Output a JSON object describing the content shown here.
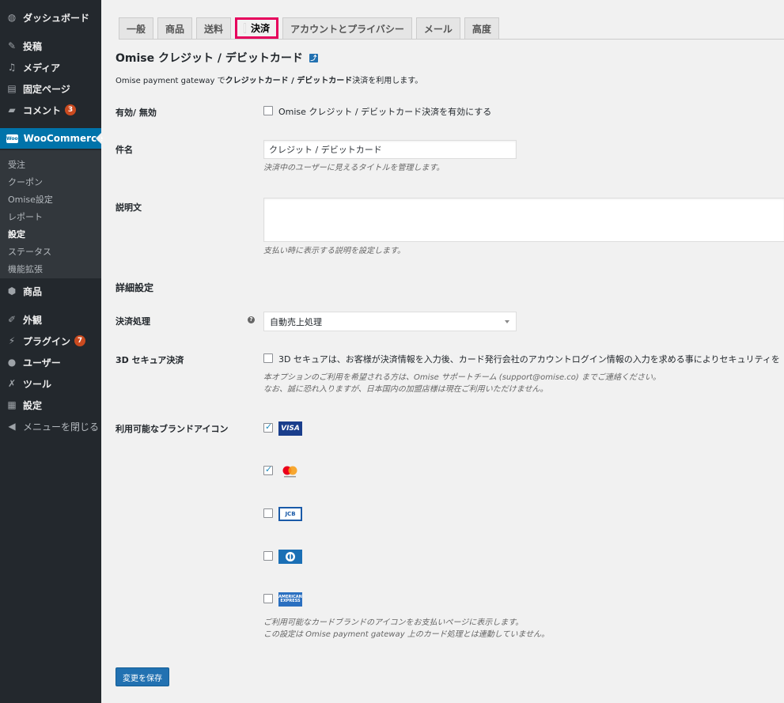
{
  "sidebar": {
    "dashboard": "ダッシュボード",
    "posts": "投稿",
    "media": "メディア",
    "pages": "固定ページ",
    "comments": "コメント",
    "comments_badge": "3",
    "woocommerce": "WooCommerce",
    "woo_logo": "Woo",
    "submenu": [
      "受注",
      "クーポン",
      "Omise設定",
      "レポート",
      "設定",
      "ステータス",
      "機能拡張"
    ],
    "products": "商品",
    "appearance": "外観",
    "plugins": "プラグイン",
    "plugins_badge": "7",
    "users": "ユーザー",
    "tools": "ツール",
    "settings": "設定",
    "collapse": "メニューを閉じる"
  },
  "tabs": [
    "一般",
    "商品",
    "送料",
    "決済",
    "アカウントとプライバシー",
    "メール",
    "高度"
  ],
  "active_tab": "決済",
  "page": {
    "title": "Omise クレジット / デビットカード",
    "back_icon": "⤴",
    "description_prefix": "Omise payment gateway で",
    "description_bold": "クレジットカード / デビットカード",
    "description_suffix": "決済を利用します。"
  },
  "form": {
    "enabled_label": "有効/ 無効",
    "enabled_checkbox_label": "Omise クレジット / デビットカード決済を有効にする",
    "enabled_checked": false,
    "title_label": "件名",
    "title_value": "クレジット / デビットカード",
    "title_hint": "決済中のユーザーに見えるタイトルを管理します。",
    "description_label": "説明文",
    "description_value": "",
    "description_hint": "支払い時に表示する説明を設定します。",
    "advanced_heading": "詳細設定",
    "payment_action_label": "決済処理",
    "payment_action_value": "自動売上処理",
    "secure3d_label": "3D セキュア決済",
    "secure3d_checkbox_label": "3D セキュアは、お客様が決済情報を入力後、カード発行会社のアカウントログイン情報の入力を求める事によりセキュリティを",
    "secure3d_checked": false,
    "secure3d_hint_1": "本オプションのご利用を希望される方は、Omise サポートチーム (support@omise.co) までご連絡ください。",
    "secure3d_hint_2": "なお、誠に恐れ入りますが、日本国内の加盟店様は現在ご利用いただけません。",
    "brands_label": "利用可能なブランドアイコン",
    "brands": [
      {
        "name": "visa",
        "text": "VISA",
        "checked": true
      },
      {
        "name": "mastercard",
        "text": "mastercard",
        "checked": true
      },
      {
        "name": "jcb",
        "text": "JCB",
        "checked": false
      },
      {
        "name": "diners",
        "text": "D",
        "checked": false
      },
      {
        "name": "amex",
        "text": "AMERICAN EXPRESS",
        "checked": false
      }
    ],
    "brands_hint_1": "ご利用可能なカードブランドのアイコンをお支払いページに表示します。",
    "brands_hint_2": "この設定は Omise payment gateway 上のカード処理とは連動していません。",
    "save_label": "変更を保存"
  },
  "colors": {
    "sidebar_bg": "#23282d",
    "active_menu": "#0073aa",
    "highlight_border": "#e6005c",
    "primary_button": "#2271b1"
  }
}
